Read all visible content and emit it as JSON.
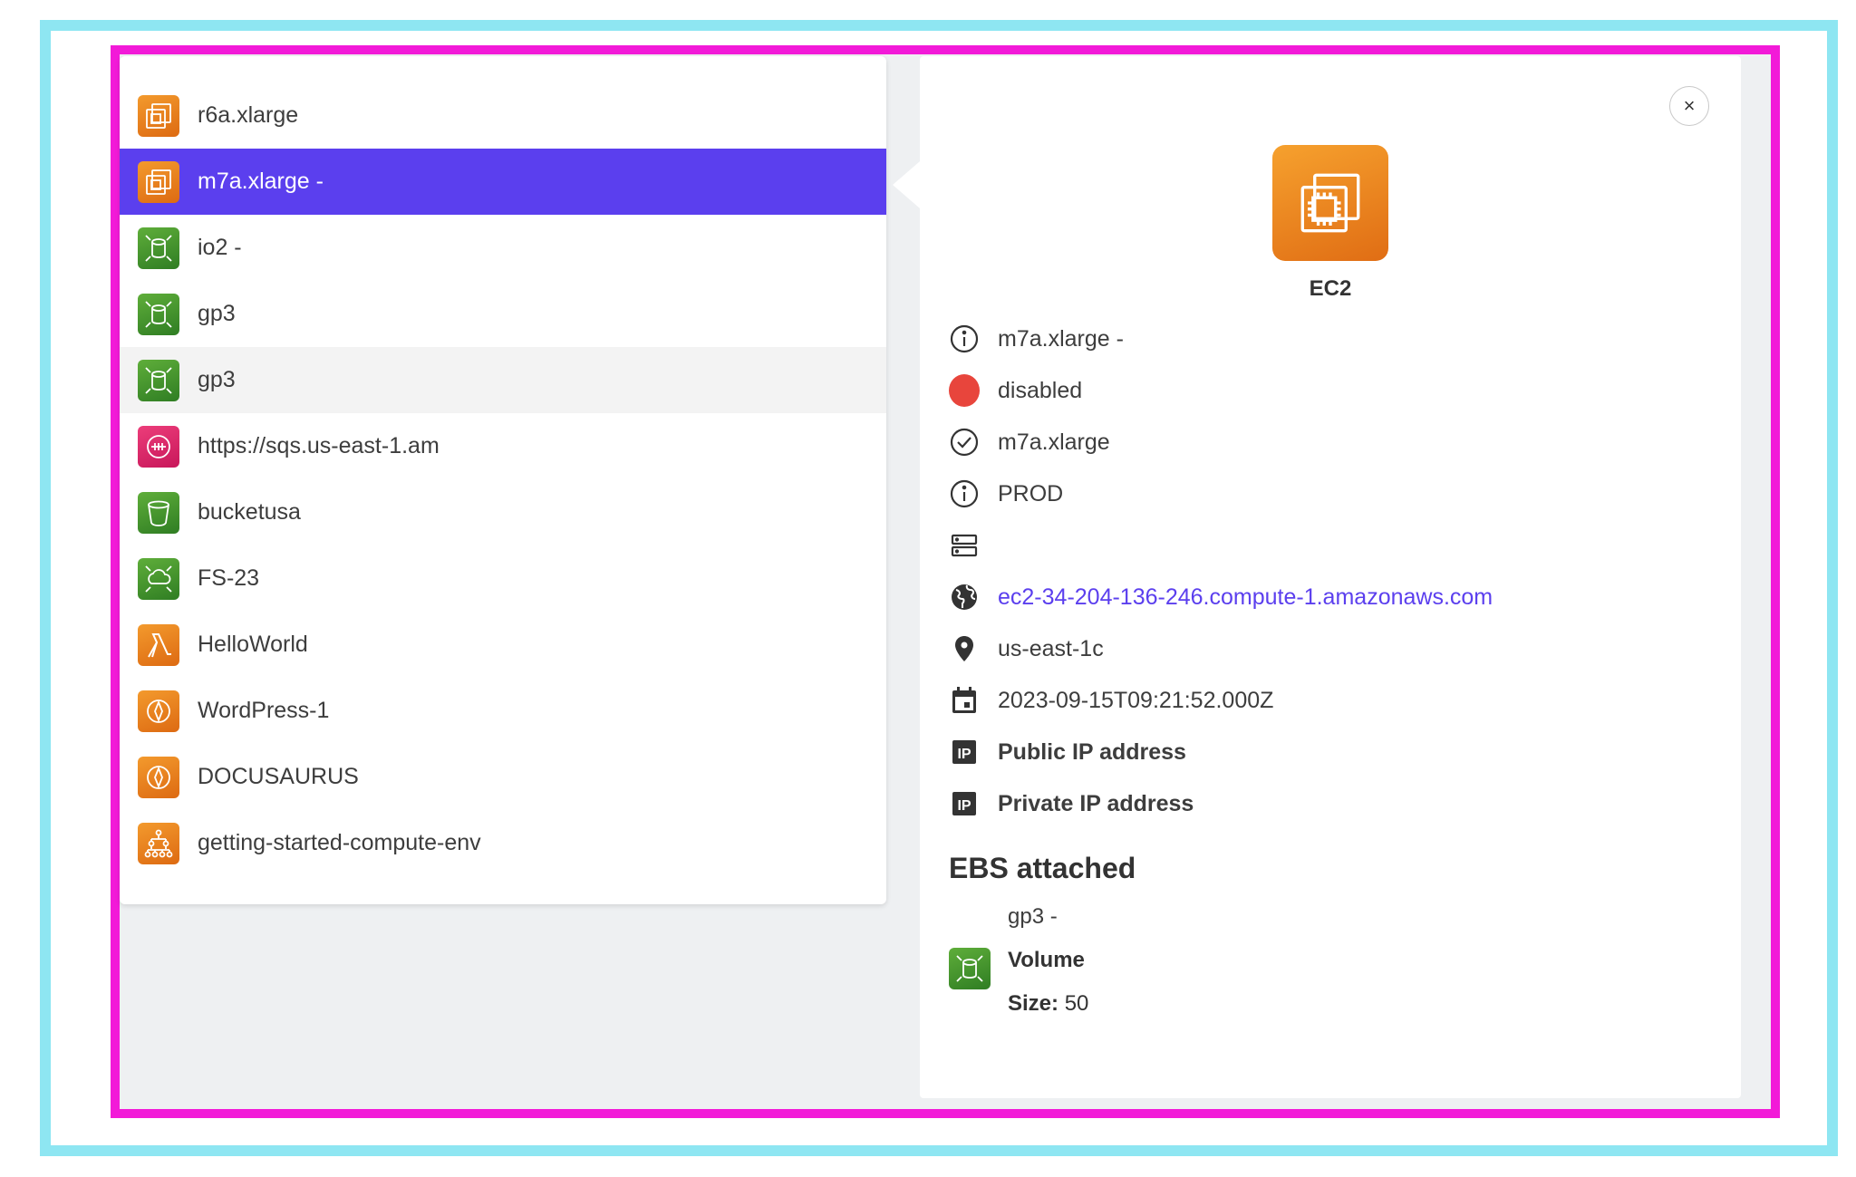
{
  "resource_list": {
    "items": [
      {
        "label": "r6a.xlarge",
        "icon": "ec2-instance-icon",
        "color": "orange",
        "state": "normal"
      },
      {
        "label": "m7a.xlarge -",
        "icon": "ec2-instance-icon",
        "color": "orange",
        "state": "selected"
      },
      {
        "label": "io2 -",
        "icon": "ebs-volume-icon",
        "color": "green",
        "state": "normal"
      },
      {
        "label": "gp3",
        "icon": "ebs-volume-icon",
        "color": "green",
        "state": "normal"
      },
      {
        "label": "gp3",
        "icon": "ebs-volume-icon",
        "color": "green",
        "state": "hovered"
      },
      {
        "label": "https://sqs.us-east-1.am",
        "icon": "sqs-queue-icon",
        "color": "pink",
        "state": "normal"
      },
      {
        "label": "bucketusa",
        "icon": "s3-bucket-icon",
        "color": "green",
        "state": "normal"
      },
      {
        "label": "FS-23",
        "icon": "efs-filesystem-icon",
        "color": "green",
        "state": "normal"
      },
      {
        "label": "HelloWorld",
        "icon": "lambda-icon",
        "color": "orange",
        "state": "normal"
      },
      {
        "label": "WordPress-1",
        "icon": "lightsail-icon",
        "color": "orange",
        "state": "normal"
      },
      {
        "label": "DOCUSAURUS",
        "icon": "lightsail-icon",
        "color": "orange",
        "state": "normal"
      },
      {
        "label": "getting-started-compute-env",
        "icon": "batch-icon",
        "color": "orange",
        "state": "normal"
      }
    ]
  },
  "detail": {
    "close_label": "×",
    "service_name": "EC2",
    "name": "m7a.xlarge -",
    "status": "disabled",
    "instance_type": "m7a.xlarge",
    "environment": "PROD",
    "storage": "",
    "dns": "ec2-34-204-136-246.compute-1.amazonaws.com",
    "availability_zone": "us-east-1c",
    "launch_time": "2023-09-15T09:21:52.000Z",
    "public_ip_label": "Public IP address",
    "private_ip_label": "Private IP address",
    "ebs_section_title": "EBS attached",
    "ebs": {
      "name": "gp3 -",
      "type_label": "Volume",
      "size_label": "Size:",
      "size_value": "50"
    }
  },
  "colors": {
    "accent": "#5b3fee",
    "status_disabled": "#e8453c",
    "frame_outer": "#8ee6f2",
    "frame_inner": "#f21ad8"
  }
}
